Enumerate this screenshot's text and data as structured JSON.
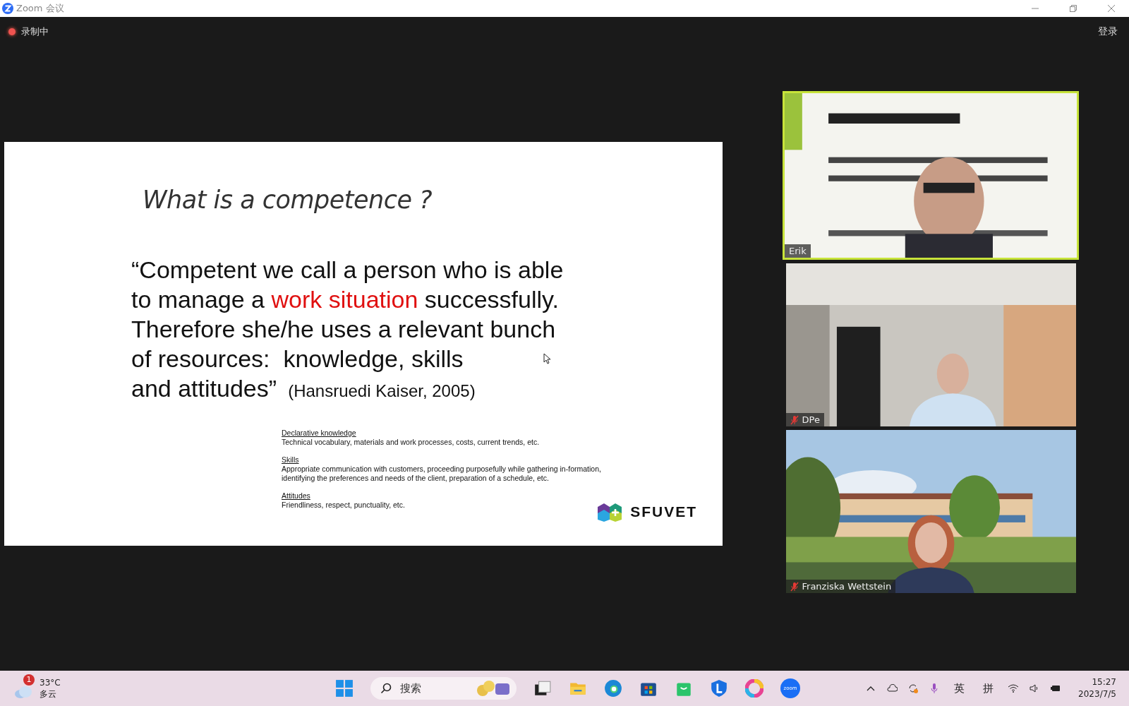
{
  "window": {
    "title": "Zoom 会议"
  },
  "meeting": {
    "recording": true,
    "recording_label": "录制中",
    "login": "登录"
  },
  "slide": {
    "title": "What is a competence ?",
    "quote_lines": [
      [
        {
          "text": "“Competent we call a person who is able",
          "highlight": false
        }
      ],
      [
        {
          "text": "to manage a ",
          "highlight": false
        },
        {
          "text": "work situation",
          "highlight": true
        },
        {
          "text": " successfully.",
          "highlight": false
        }
      ],
      [
        {
          "text": "Therefore she/he uses a relevant bunch",
          "highlight": false
        }
      ],
      [
        {
          "text": "of resources:  knowledge, skills",
          "highlight": false
        }
      ],
      [
        {
          "text": "and attitudes”",
          "highlight": false
        }
      ]
    ],
    "citation": "(Hansruedi Kaiser, 2005)",
    "notes": [
      {
        "heading": "Declarative knowledge",
        "lines": [
          "Technical vocabulary, materials and work processes, costs, current trends, etc."
        ]
      },
      {
        "heading": "Skills",
        "lines": [
          "Appropriate communication with customers, proceeding purposefully while gathering in-formation,",
          "identifying the preferences and needs of the client, preparation of a schedule, etc."
        ]
      },
      {
        "heading": "Attitudes",
        "lines": [
          "Friendliness, respect, punctuality, etc."
        ]
      }
    ],
    "logo": "SFUVET"
  },
  "participants": [
    {
      "name": "Erik",
      "muted": false,
      "speaking": true
    },
    {
      "name": "DPe",
      "muted": true,
      "speaking": false
    },
    {
      "name": "Franziska Wettstein",
      "muted": true,
      "speaking": false
    }
  ],
  "taskbar": {
    "weather": {
      "badge": "1",
      "temperature": "33°C",
      "condition": "多云"
    },
    "search_placeholder": "搜索",
    "zoom_label": "zoom",
    "ime": [
      "英",
      "拼"
    ],
    "time": "15:27",
    "date": "2023/7/5"
  }
}
